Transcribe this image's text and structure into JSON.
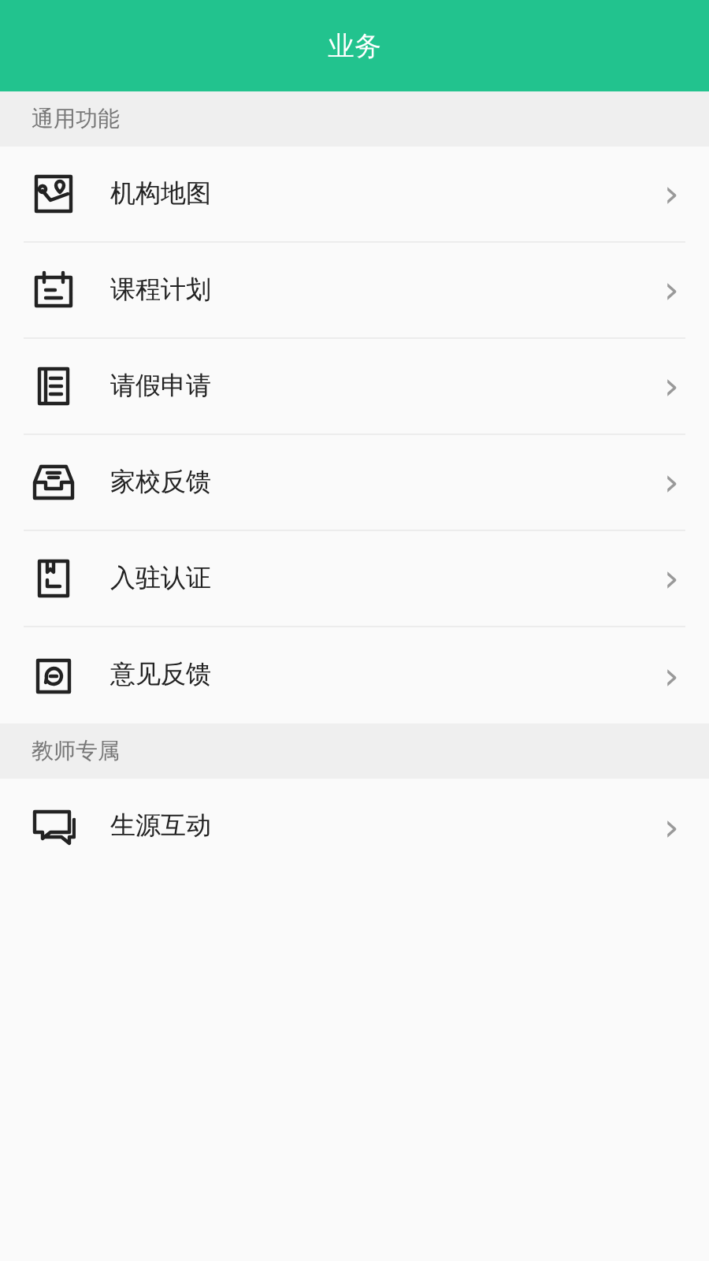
{
  "header": {
    "title": "业务"
  },
  "sections": [
    {
      "title": "通用功能",
      "items": [
        {
          "label": "机构地图",
          "chevron": "›"
        },
        {
          "label": "课程计划",
          "chevron": "›"
        },
        {
          "label": "请假申请",
          "chevron": "›"
        },
        {
          "label": "家校反馈",
          "chevron": "›"
        },
        {
          "label": "入驻认证",
          "chevron": "›"
        },
        {
          "label": "意见反馈",
          "chevron": "›"
        }
      ]
    },
    {
      "title": "教师专属",
      "items": [
        {
          "label": "生源互动",
          "chevron": "›"
        }
      ]
    }
  ]
}
